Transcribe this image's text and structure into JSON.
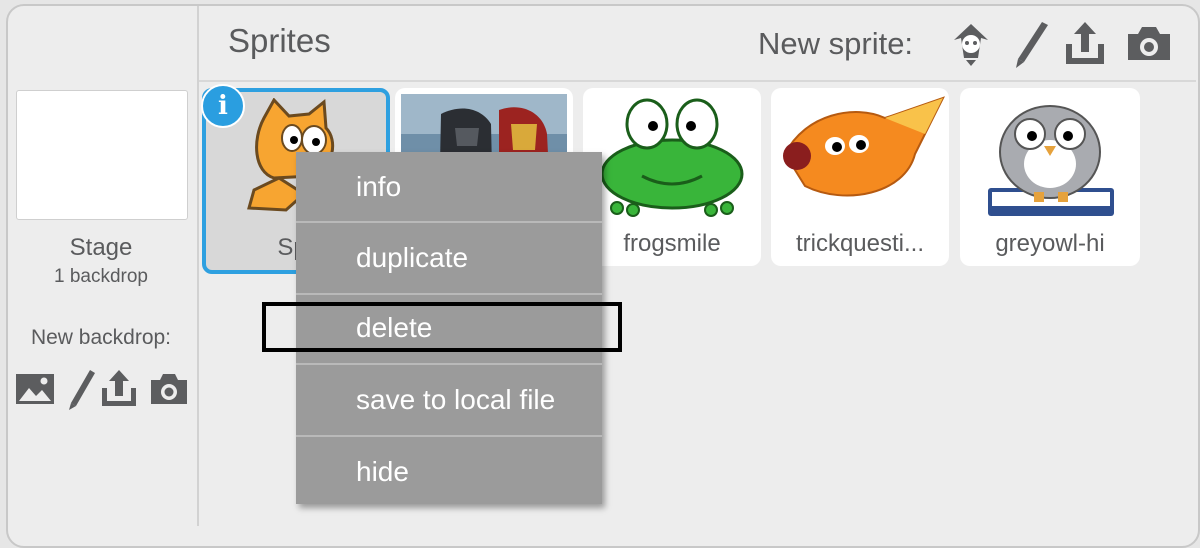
{
  "header": {
    "title": "Sprites",
    "new_sprite_label": "New sprite:",
    "icons": [
      "choose-sprite-from-library-icon",
      "paint-new-sprite-icon",
      "upload-sprite-icon",
      "camera-icon"
    ]
  },
  "stage": {
    "label": "Stage",
    "backdrop_count": "1 backdrop",
    "new_backdrop_label": "New backdrop:",
    "icons": [
      "choose-backdrop-from-library-icon",
      "paint-new-backdrop-icon",
      "upload-backdrop-icon",
      "camera-icon"
    ]
  },
  "sprites": [
    {
      "name": "Spr",
      "selected": true
    },
    {
      "name": "",
      "selected": false
    },
    {
      "name": "frogsmile",
      "selected": false
    },
    {
      "name": "trickquesti...",
      "selected": false
    },
    {
      "name": "greyowl-hi",
      "selected": false
    }
  ],
  "info_badge": "i",
  "context_menu": {
    "items": [
      "info",
      "duplicate",
      "delete",
      "save to local file",
      "hide"
    ],
    "highlighted": "delete"
  },
  "colors": {
    "selection_accent": "#2ea0e0",
    "menu_background": "#9b9b9b",
    "menu_text": "#ffffff"
  }
}
